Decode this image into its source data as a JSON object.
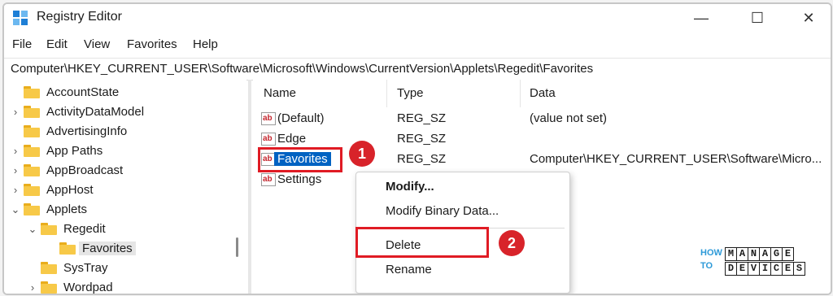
{
  "window": {
    "title": "Registry Editor",
    "minimize_glyph": "—",
    "maximize_glyph": "☐",
    "close_glyph": "✕"
  },
  "menu": [
    "File",
    "Edit",
    "View",
    "Favorites",
    "Help"
  ],
  "address": "Computer\\HKEY_CURRENT_USER\\Software\\Microsoft\\Windows\\CurrentVersion\\Applets\\Regedit\\Favorites",
  "tree": [
    {
      "label": "AccountState",
      "chevron": ""
    },
    {
      "label": "ActivityDataModel",
      "chevron": "›"
    },
    {
      "label": "AdvertisingInfo",
      "chevron": ""
    },
    {
      "label": "App Paths",
      "chevron": "›"
    },
    {
      "label": "AppBroadcast",
      "chevron": "›"
    },
    {
      "label": "AppHost",
      "chevron": "›"
    },
    {
      "label": "Applets",
      "chevron": "⌄"
    },
    {
      "label": "Regedit",
      "chevron": "⌄"
    },
    {
      "label": "Favorites",
      "chevron": ""
    },
    {
      "label": "SysTray",
      "chevron": ""
    },
    {
      "label": "Wordpad",
      "chevron": "›"
    }
  ],
  "columns": {
    "name": "Name",
    "type": "Type",
    "data": "Data"
  },
  "values": [
    {
      "icon": "ab",
      "name": "(Default)",
      "type": "REG_SZ",
      "data": "(value not set)"
    },
    {
      "icon": "ab",
      "name": "Edge",
      "type": "REG_SZ",
      "data": ""
    },
    {
      "icon": "ab",
      "name": "Favorites",
      "type": "REG_SZ",
      "data": "Computer\\HKEY_CURRENT_USER\\Software\\Micro..."
    },
    {
      "icon": "ab",
      "name": "Settings",
      "type": "",
      "data": ""
    }
  ],
  "context_menu": {
    "modify": "Modify...",
    "modify_binary": "Modify Binary Data...",
    "delete": "Delete",
    "rename": "Rename"
  },
  "annotations": {
    "step1": "1",
    "step2": "2"
  },
  "watermark": {
    "how": "HOW",
    "to": "TO",
    "manage": "MANAGE",
    "devices": "DEVICES"
  },
  "colors": {
    "accent": "#0062c2",
    "annotation": "#e01b24",
    "folder": "#f7c948"
  }
}
